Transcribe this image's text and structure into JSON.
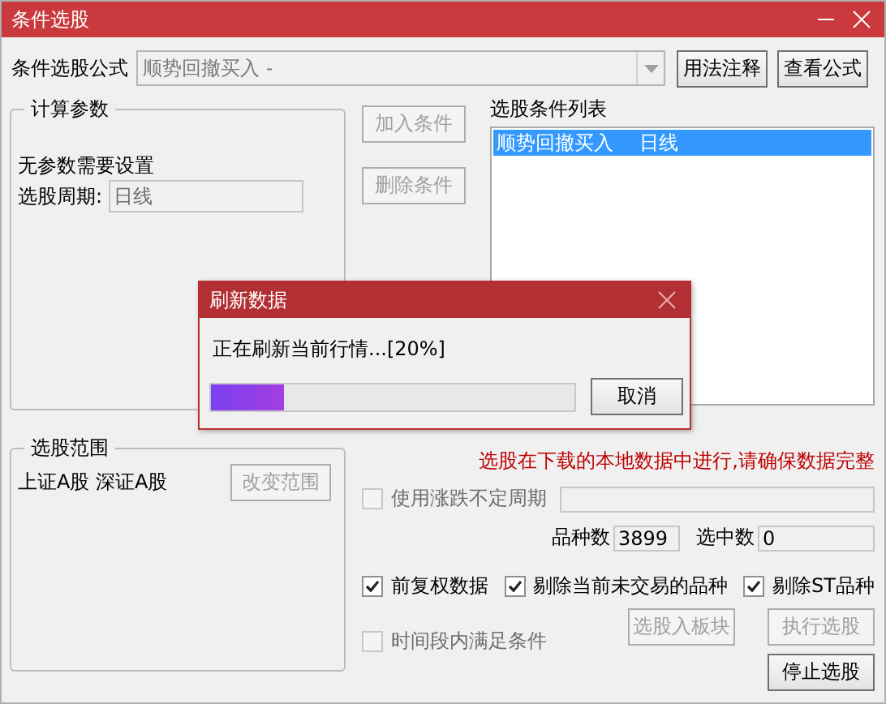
{
  "window": {
    "title": "条件选股"
  },
  "formula": {
    "label": "条件选股公式",
    "value": "顺势回撤买入 -",
    "disabled": true
  },
  "formula_buttons": [
    {
      "label": "用法注释",
      "disabled": false
    },
    {
      "label": "查看公式",
      "disabled": false
    }
  ],
  "params_group": {
    "title": "计算参数",
    "message": "无参数需要设置",
    "period_label": "选股周期:",
    "period_value": "日线"
  },
  "condition_buttons": [
    {
      "label": "加入条件",
      "disabled": true
    },
    {
      "label": "删除条件",
      "disabled": true
    }
  ],
  "condition_list": {
    "label": "选股条件列表",
    "items": [
      {
        "name": "顺势回撤买入",
        "period": "日线",
        "selected": true
      }
    ]
  },
  "scope_group": {
    "title": "选股范围",
    "markets": "上证A股 深证A股",
    "button": {
      "label": "改变范围",
      "disabled": true
    }
  },
  "notice": "选股在下载的本地数据中进行,请确保数据完整",
  "variable_period": {
    "label": "使用涨跌不定周期",
    "checked": false,
    "disabled": true
  },
  "counts": [
    {
      "label": "品种数",
      "value": "3899"
    },
    {
      "label": "选中数",
      "value": "0"
    }
  ],
  "options": [
    {
      "label": "前复权数据",
      "checked": true,
      "disabled": false
    },
    {
      "label": "剔除当前未交易的品种",
      "checked": true,
      "disabled": false
    },
    {
      "label": "剔除ST品种",
      "checked": true,
      "disabled": false
    }
  ],
  "time_range": {
    "label": "时间段内满足条件",
    "checked": false,
    "disabled": true
  },
  "action_buttons": [
    {
      "label": "选股入板块",
      "disabled": true
    },
    {
      "label": "执行选股",
      "disabled": true
    },
    {
      "label": "停止选股",
      "disabled": false
    }
  ],
  "dialog": {
    "title": "刷新数据",
    "message": "正在刷新当前行情...[20%]",
    "level": 0.2,
    "button": "取消"
  }
}
